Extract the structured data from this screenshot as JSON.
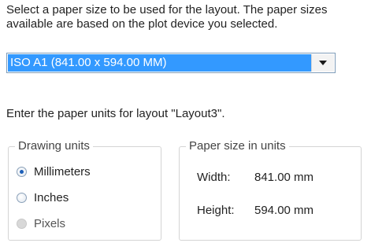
{
  "intro_text": "Select a paper size to be used for the layout.  The paper sizes available are based on the plot device you selected.",
  "paper_size": {
    "selected": "ISO A1 (841.00 x 594.00 MM)"
  },
  "units_prompt": "Enter the paper units for layout \"Layout3\".",
  "drawing_units": {
    "legend": "Drawing units",
    "options": [
      {
        "label": "Millimeters",
        "checked": true
      },
      {
        "label": "Inches",
        "checked": false
      },
      {
        "label": "Pixels",
        "checked": false,
        "disabled": true
      }
    ]
  },
  "paper_size_units": {
    "legend": "Paper size in units",
    "width_label": "Width:",
    "width_value": "841.00 mm",
    "height_label": "Height:",
    "height_value": "594.00 mm"
  }
}
